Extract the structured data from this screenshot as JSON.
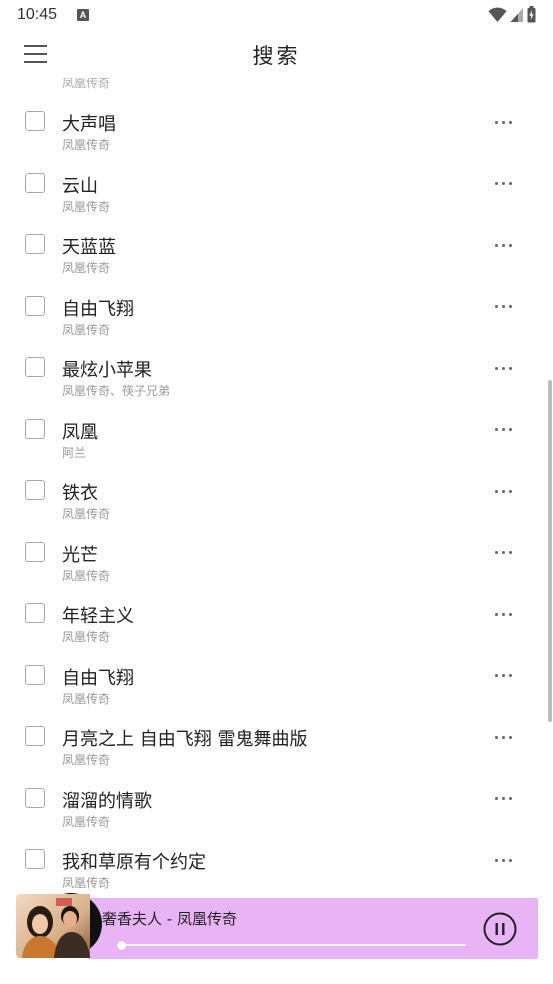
{
  "status_bar": {
    "time": "10:45",
    "notification_icon": "A"
  },
  "app_bar": {
    "title": "搜索"
  },
  "list": {
    "partial_top_artist": "凤凰传奇",
    "items": [
      {
        "title": "大声唱",
        "artist": "凤凰传奇"
      },
      {
        "title": "云山",
        "artist": "凤凰传奇"
      },
      {
        "title": "天蓝蓝",
        "artist": "凤凰传奇"
      },
      {
        "title": "自由飞翔",
        "artist": "凤凰传奇"
      },
      {
        "title": "最炫小苹果",
        "artist": "凤凰传奇、筷子兄弟"
      },
      {
        "title": "凤凰",
        "artist": "阿兰"
      },
      {
        "title": "铁衣",
        "artist": "凤凰传奇"
      },
      {
        "title": "光芒",
        "artist": "凤凰传奇"
      },
      {
        "title": "年轻主义",
        "artist": "凤凰传奇"
      },
      {
        "title": "自由飞翔",
        "artist": "凤凰传奇"
      },
      {
        "title": "月亮之上 自由飞翔 雷鬼舞曲版",
        "artist": "凤凰传奇"
      },
      {
        "title": "溜溜的情歌",
        "artist": "凤凰传奇"
      },
      {
        "title": "我和草原有个约定",
        "artist": "凤凰传奇"
      }
    ]
  },
  "player": {
    "now_playing": "奢香夫人 - 凤凰传奇",
    "progress": 0.01,
    "state": "playing",
    "background_color": "#e8b4f5"
  },
  "icons": {
    "menu": "menu-icon",
    "more": "more-horizontal-icon",
    "pause": "pause-circle-icon",
    "wifi": "wifi-icon",
    "signal": "cell-signal-icon",
    "battery": "battery-charging-icon"
  }
}
